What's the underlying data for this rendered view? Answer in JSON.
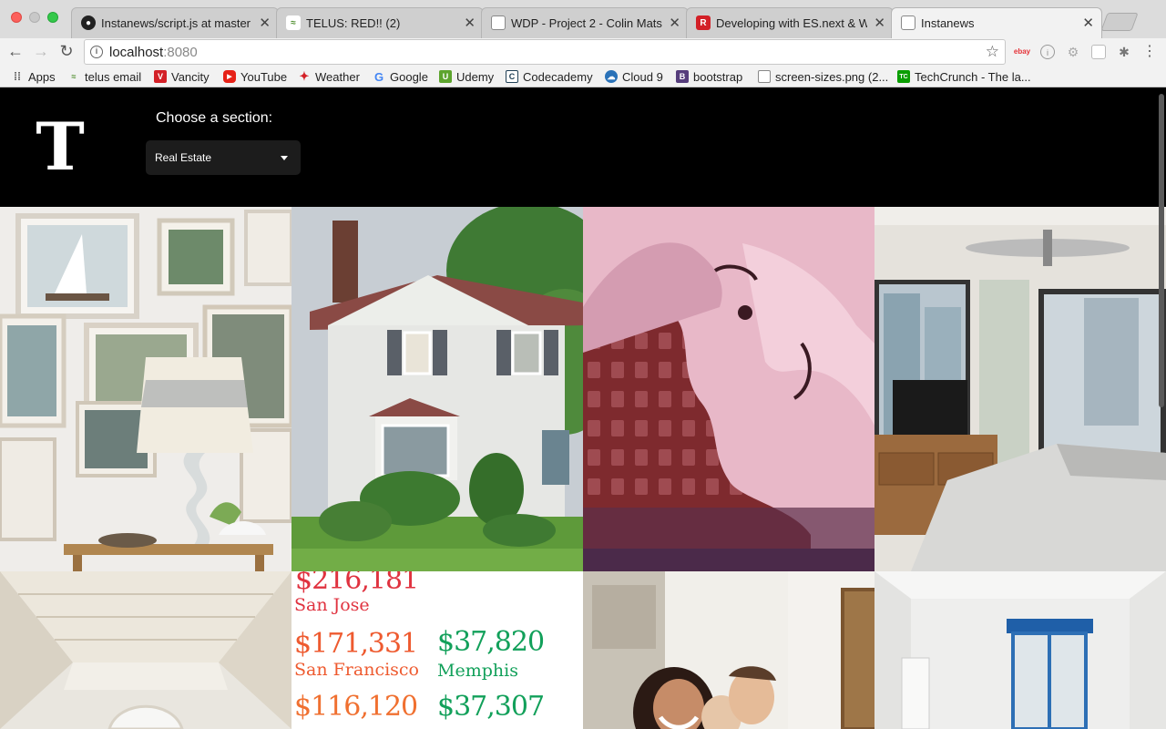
{
  "browser": {
    "tabs": [
      {
        "title": "Instanews/script.js at master · ",
        "icon": "github-icon"
      },
      {
        "title": "TELUS: RED!! (2)",
        "icon": "telus-icon"
      },
      {
        "title": "WDP - Project 2 - Colin Matso",
        "icon": "document-icon"
      },
      {
        "title": "Developing with ES.next & We",
        "icon": "r-icon"
      },
      {
        "title": "Instanews",
        "icon": "document-icon"
      }
    ],
    "url_host": "localhost",
    "url_port": ":8080",
    "bookmarks": [
      {
        "label": "Apps",
        "icon": "apps-grid-icon"
      },
      {
        "label": "telus email",
        "icon": "telus-icon"
      },
      {
        "label": "Vancity",
        "icon": "vancity-icon"
      },
      {
        "label": "YouTube",
        "icon": "youtube-icon"
      },
      {
        "label": "Weather",
        "icon": "maple-leaf-icon"
      },
      {
        "label": "Google",
        "icon": "google-icon"
      },
      {
        "label": "Udemy",
        "icon": "udemy-icon"
      },
      {
        "label": "Codecademy",
        "icon": "codecademy-icon"
      },
      {
        "label": "Cloud 9",
        "icon": "cloud9-icon"
      },
      {
        "label": "bootstrap",
        "icon": "bootstrap-icon"
      },
      {
        "label": "screen-sizes.png (2...",
        "icon": "file-icon"
      },
      {
        "label": "TechCrunch - The la...",
        "icon": "techcrunch-icon"
      }
    ]
  },
  "header": {
    "logo_letter": "T",
    "section_prompt": "Choose a section:",
    "section_selected": "Real Estate"
  },
  "infographic": {
    "items": [
      {
        "price": "$216,181",
        "city": "San Jose"
      },
      {
        "price": "$171,331",
        "city": "San Francisco"
      },
      {
        "price": "$37,820",
        "city": "Memphis"
      },
      {
        "price": "$116,120",
        "city": ""
      },
      {
        "price": "$37,307",
        "city": ""
      }
    ]
  }
}
